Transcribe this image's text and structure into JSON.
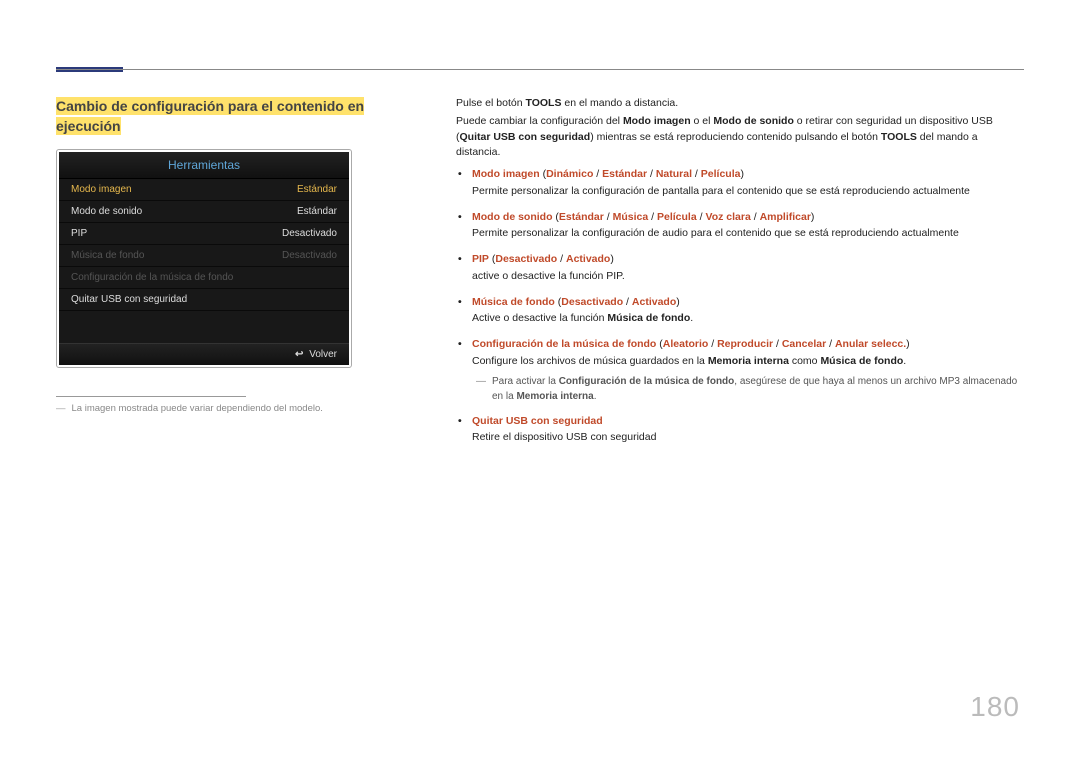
{
  "section_title_line1": "Cambio de configuración para el contenido en",
  "section_title_line2": "ejecución",
  "ui": {
    "header": "Herramientas",
    "rows": [
      {
        "label": "Modo imagen",
        "value": "Estándar",
        "cls": "selected"
      },
      {
        "label": "Modo de sonido",
        "value": "Estándar",
        "cls": ""
      },
      {
        "label": "PIP",
        "value": "Desactivado",
        "cls": ""
      },
      {
        "label": "Música de fondo",
        "value": "Desactivado",
        "cls": "dim"
      },
      {
        "label": "Configuración de la música de fondo",
        "value": "",
        "cls": "dim"
      },
      {
        "label": "Quitar USB con seguridad",
        "value": "",
        "cls": ""
      }
    ],
    "footer_icon": "↩",
    "footer_text": "Volver"
  },
  "footnote": "La imagen mostrada puede variar dependiendo del modelo.",
  "intro": {
    "p1_a": "Pulse el botón ",
    "p1_b": "TOOLS",
    "p1_c": " en el mando a distancia.",
    "p2_a": "Puede cambiar la configuración del ",
    "p2_b": "Modo imagen",
    "p2_c": " o el ",
    "p2_d": "Modo de sonido",
    "p2_e": " o retirar con seguridad un dispositivo USB (",
    "p2_f": "Quitar USB con seguridad",
    "p2_g": ") mientras se está reproduciendo contenido pulsando el botón ",
    "p2_h": "TOOLS",
    "p2_i": " del mando a distancia."
  },
  "bullets": {
    "b1": {
      "t1": "Modo imagen",
      "t2": " (",
      "t3": "Dinámico",
      "t4": " / ",
      "t5": "Estándar",
      "t6": " / ",
      "t7": "Natural",
      "t8": " / ",
      "t9": "Película",
      "t10": ")",
      "desc": "Permite personalizar la configuración de pantalla para el contenido que se está reproduciendo actualmente"
    },
    "b2": {
      "t1": "Modo de sonido",
      "t2": " (",
      "t3": "Estándar",
      "t4": " / ",
      "t5": "Música",
      "t6": " / ",
      "t7": "Película",
      "t8": " / ",
      "t9": "Voz clara",
      "t10": " / ",
      "t11": "Amplificar",
      "t12": ")",
      "desc": "Permite personalizar la configuración de audio para el contenido que se está reproduciendo actualmente"
    },
    "b3": {
      "t1": "PIP",
      "t2": " (",
      "t3": "Desactivado",
      "t4": " / ",
      "t5": "Activado",
      "t6": ")",
      "desc": "active o desactive la función PIP."
    },
    "b4": {
      "t1": "Música de fondo",
      "t2": " (",
      "t3": "Desactivado",
      "t4": " / ",
      "t5": "Activado",
      "t6": ")",
      "desc_a": "Active o desactive la función ",
      "desc_b": "Música de fondo",
      "desc_c": "."
    },
    "b5": {
      "t1": "Configuración de la música de fondo",
      "t2": " (",
      "t3": "Aleatorio",
      "t4": " / ",
      "t5": "Reproducir",
      "t6": " / ",
      "t7": "Cancelar",
      "t8": " / ",
      "t9": "Anular selecc.",
      "t10": ")",
      "desc_a": "Configure los archivos de música guardados en la ",
      "desc_b": "Memoria interna",
      "desc_c": " como ",
      "desc_d": "Música de fondo",
      "desc_e": ".",
      "note_a": "Para activar la ",
      "note_b": "Configuración de la música de fondo",
      "note_c": ", asegúrese de que haya al menos un archivo MP3 almacenado en la ",
      "note_d": "Memoria interna",
      "note_e": "."
    },
    "b6": {
      "t1": "Quitar USB con seguridad",
      "desc": "Retire el dispositivo USB con seguridad"
    }
  },
  "page_number": "180"
}
